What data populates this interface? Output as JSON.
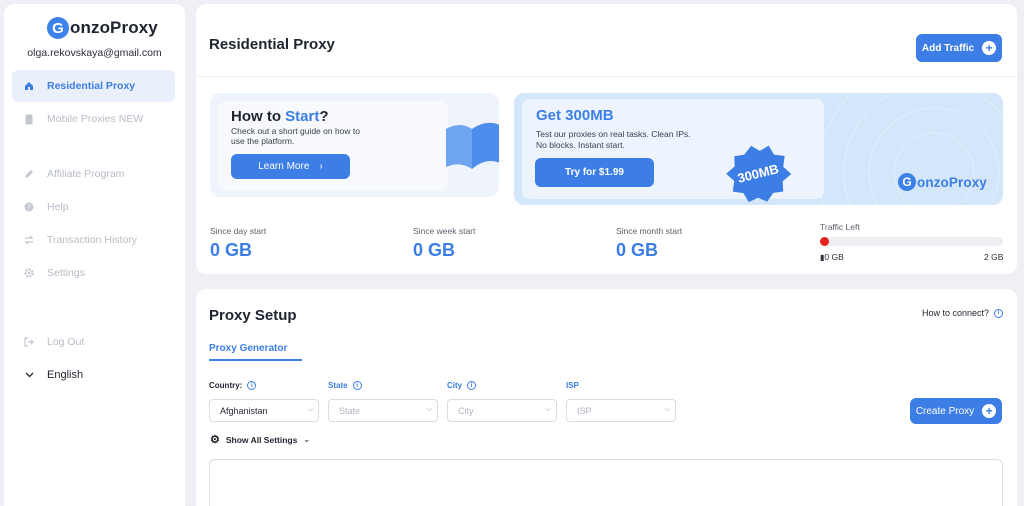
{
  "brand": {
    "logo_letter": "G",
    "logo_rest": "onzoProxy"
  },
  "user": {
    "email": "olga.rekovskaya@gmail.com"
  },
  "sidebar": {
    "items": [
      {
        "label": "Residential Proxy",
        "icon": "home-icon",
        "active": true
      },
      {
        "label": "Mobile Proxies NEW",
        "icon": "phone-icon"
      },
      {
        "label": "Affiliate Program",
        "icon": "pen-icon"
      },
      {
        "label": "Help",
        "icon": "help-icon"
      },
      {
        "label": "Transaction History",
        "icon": "swap-icon"
      },
      {
        "label": "Settings",
        "icon": "gear-icon"
      },
      {
        "label": "Log Out",
        "icon": "logout-icon"
      },
      {
        "label": "English",
        "icon": "chevron-down-icon"
      }
    ]
  },
  "header": {
    "title": "Residential Proxy",
    "add_traffic_label": "Add Traffic"
  },
  "banner_start": {
    "title_prefix": "How to ",
    "title_highlight": "Start",
    "title_suffix": "?",
    "description": "Check out a short guide on how to use the platform.",
    "button_label": "Learn More"
  },
  "banner_promo": {
    "title": "Get 300MB",
    "description": "Test our proxies on real tasks. Clean IPs. No blocks. Instant start.",
    "button_label": "Try for $1.99",
    "badge_text": "300MB",
    "logo_letter": "G",
    "logo_rest": "onzoProxy"
  },
  "stats": [
    {
      "label": "Since day start",
      "value": "0 GB"
    },
    {
      "label": "Since week start",
      "value": "0 GB"
    },
    {
      "label": "Since month start",
      "value": "0 GB"
    }
  ],
  "traffic": {
    "label": "Traffic Left",
    "min_label": "0 GB",
    "max_label": "2 GB",
    "used_fraction": 0
  },
  "setup": {
    "title": "Proxy Setup",
    "how_to_connect": "How to connect?",
    "tab_label": "Proxy Generator",
    "fields": [
      {
        "label": "Country:",
        "value": "Afghanistan"
      },
      {
        "label": "State",
        "placeholder": "State"
      },
      {
        "label": "City",
        "placeholder": "City"
      },
      {
        "label": "ISP",
        "placeholder": "ISP"
      }
    ],
    "create_label": "Create Proxy",
    "show_all_label": "Show All Settings"
  },
  "colors": {
    "accent": "#3c7ee6",
    "traffic_dot": "#e5201e"
  }
}
